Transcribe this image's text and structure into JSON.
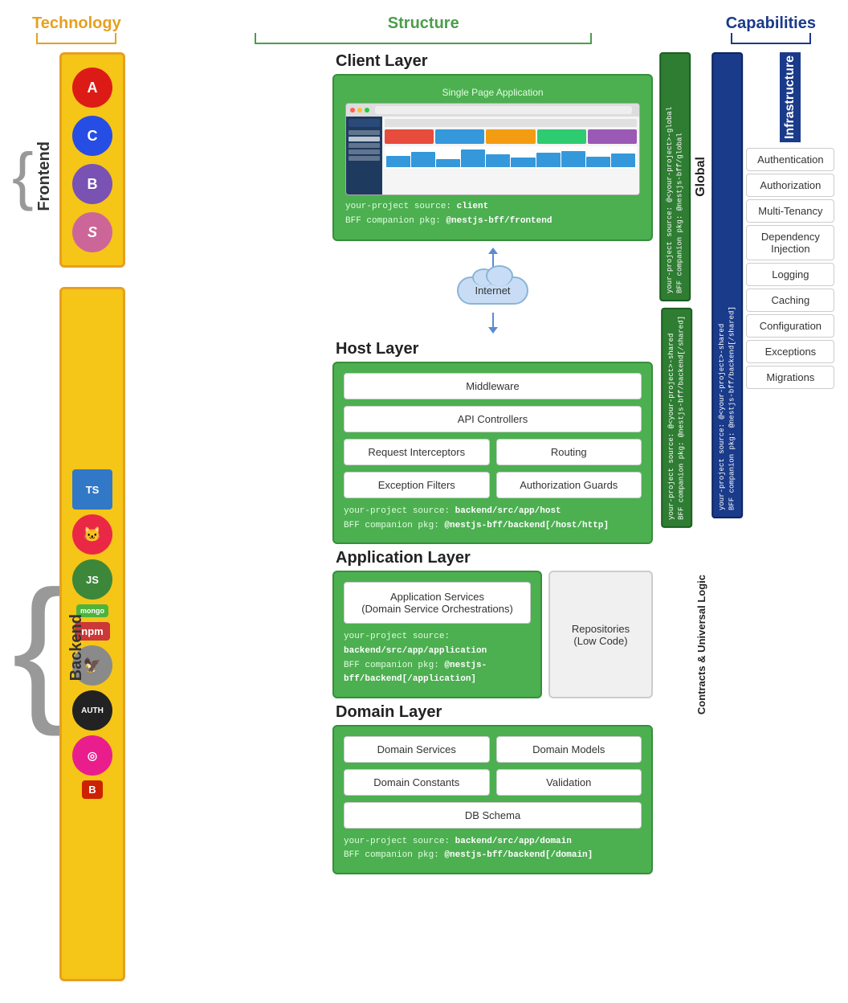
{
  "header": {
    "technology": "Technology",
    "structure": "Structure",
    "capabilities": "Capabilities"
  },
  "frontend": {
    "label": "Frontend",
    "icons": [
      {
        "name": "Angular",
        "symbol": "A",
        "class": "icon-angular"
      },
      {
        "name": "CSS",
        "symbol": "C",
        "class": "icon-css"
      },
      {
        "name": "Bootstrap",
        "symbol": "B",
        "class": "icon-bootstrap"
      },
      {
        "name": "Sass",
        "symbol": "S",
        "class": "icon-sass"
      }
    ],
    "client_layer": {
      "title": "Client Layer",
      "spa_label": "Single Page Application",
      "source_line1": "your-project source: ",
      "source_val1": "client",
      "source_line2": "BFF companion pkg: ",
      "source_val2": "@nestjs-bff/frontend"
    }
  },
  "backend": {
    "label": "Backend",
    "icons": [
      {
        "name": "TypeScript",
        "symbol": "TS",
        "class": "icon-ts"
      },
      {
        "name": "NestJS",
        "symbol": "🐈",
        "class": "icon-nest"
      },
      {
        "name": "NodeJS",
        "symbol": "JS",
        "class": "icon-node"
      },
      {
        "name": "MongoDB",
        "symbol": "mongo",
        "class": "icon-mongo"
      },
      {
        "name": "NPM",
        "symbol": "npm",
        "class": "icon-npm"
      },
      {
        "name": "Mythical",
        "symbol": "✦",
        "class": "icon-mythical"
      },
      {
        "name": "OAuth",
        "symbol": "A",
        "class": "icon-oauth"
      },
      {
        "name": "NX",
        "symbol": "◎",
        "class": "icon-nx"
      },
      {
        "name": "Bull",
        "symbol": "B",
        "class": "icon-bull"
      }
    ],
    "host_layer": {
      "title": "Host Layer",
      "middleware": "Middleware",
      "api_controllers": "API Controllers",
      "request_interceptors": "Request Interceptors",
      "routing": "Routing",
      "exception_filters": "Exception Filters",
      "authorization_guards": "Authorization Guards",
      "source_line1": "your-project source: ",
      "source_val1": "backend/src/app/host",
      "source_line2": "BFF companion pkg: ",
      "source_val2": "@nestjs-bff/backend[/host/http]"
    },
    "application_layer": {
      "title": "Application Layer",
      "app_services": "Application Services\n(Domain Service Orchestrations)",
      "source_line1": "your-project source: ",
      "source_val1": "backend/src/app/application",
      "source_line2": "BFF companion pkg: ",
      "source_val2": "@nestjs-bff/backend[/application]",
      "repositories": "Repositories\n(Low Code)"
    },
    "domain_layer": {
      "title": "Domain Layer",
      "domain_services": "Domain Services",
      "domain_models": "Domain Models",
      "domain_constants": "Domain Constants",
      "validation": "Validation",
      "db_schema": "DB Schema",
      "source_line1": "your-project source: ",
      "source_val1": "backend/src/app/domain",
      "source_line2": "BFF companion pkg: ",
      "source_val2": "@nestjs-bff/backend[/domain]"
    }
  },
  "internet": {
    "label": "Internet"
  },
  "global": {
    "label": "Global",
    "bar_text": "your-project source: @<your-project>-global\nBFF companion pkg: @nestjs-bff/global"
  },
  "contracts": {
    "bar_text": "your-project source: @<your-project>-shared\nBFF companion pkg: @nestjs-bff/backend[/shared]",
    "label": "Contracts & Universal Logic"
  },
  "infrastructure": {
    "label": "Infrastructure",
    "bar_text": "your-project source: @<your-project>-shared\nBFF companion pkg: @nestjs-bff/backend[/shared]",
    "items": [
      "Authentication",
      "Authorization",
      "Multi-Tenancy",
      "Dependency\nInjection",
      "Logging",
      "Caching",
      "Configuration",
      "Exceptions",
      "Migrations"
    ]
  }
}
